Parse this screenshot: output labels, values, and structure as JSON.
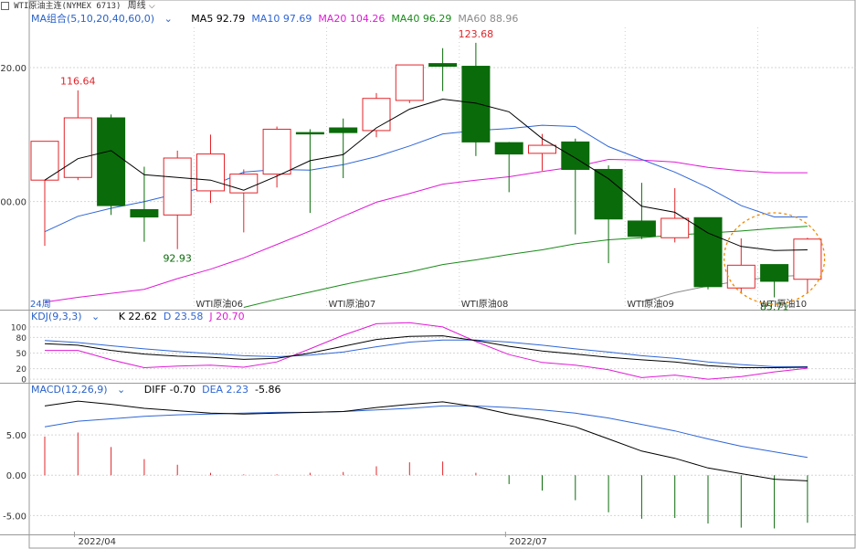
{
  "header": {
    "icon": "square-icon",
    "symbol": "WTI原油主连(NYMEX 6713)",
    "period": "周线",
    "dropdown_icon": "chevron-down-icon"
  },
  "colors": {
    "up": "#e2242a",
    "down": "#0a6b0a",
    "ma5": "#000000",
    "ma10": "#2f66d6",
    "ma20": "#e01ad6",
    "ma40": "#1a8a1a",
    "ma60": "#8a8a8a",
    "k": "#000000",
    "d": "#2f66d6",
    "j": "#e01ad6",
    "grid": "#d6d6d6",
    "axis_text": "#333333",
    "label_blue": "#2a62c9",
    "highlight_circle": "#f08a00"
  },
  "legends": {
    "ma": {
      "title": "MA组合(5,10,20,40,60,0)",
      "items": [
        {
          "text": "MA5 92.79",
          "color_key": "ma5"
        },
        {
          "text": "MA10 97.69",
          "color_key": "ma10"
        },
        {
          "text": "MA20 104.26",
          "color_key": "ma20"
        },
        {
          "text": "MA40 96.29",
          "color_key": "ma40"
        },
        {
          "text": "MA60 88.96",
          "color_key": "ma60"
        }
      ]
    },
    "kdj": {
      "title": "KDJ(9,3,3)",
      "items": [
        {
          "text": "K 22.62",
          "color_key": "k"
        },
        {
          "text": "D 23.58",
          "color_key": "d"
        },
        {
          "text": "J 20.70",
          "color_key": "j"
        }
      ]
    },
    "macd": {
      "title": "MACD(12,26,9)",
      "items": [
        {
          "text": "DIFF -0.70",
          "color_key": "k"
        },
        {
          "text": "DEA 2.23",
          "color_key": "d"
        },
        {
          "text": "-5.86",
          "color_key": "k"
        }
      ]
    }
  },
  "chart_data": {
    "type": "candlestick",
    "price_axis": {
      "ticks": [
        100,
        120
      ],
      "tick_labels": [
        "100.00",
        "120.00"
      ],
      "range": [
        84,
        126
      ]
    },
    "candles": [
      {
        "o": 103.2,
        "h": 108.5,
        "l": 93.4,
        "c": 109.0
      },
      {
        "o": 103.6,
        "h": 116.6,
        "l": 103.2,
        "c": 112.5
      },
      {
        "o": 112.5,
        "h": 113.0,
        "l": 98.0,
        "c": 99.4
      },
      {
        "o": 98.8,
        "h": 105.2,
        "l": 94.0,
        "c": 97.7
      },
      {
        "o": 98.0,
        "h": 107.6,
        "l": 92.9,
        "c": 106.5
      },
      {
        "o": 101.6,
        "h": 110.0,
        "l": 99.8,
        "c": 107.1
      },
      {
        "o": 101.3,
        "h": 104.8,
        "l": 95.4,
        "c": 104.1
      },
      {
        "o": 104.1,
        "h": 111.2,
        "l": 102.1,
        "c": 110.8
      },
      {
        "o": 110.3,
        "h": 110.8,
        "l": 98.3,
        "c": 110.2
      },
      {
        "o": 111.0,
        "h": 112.4,
        "l": 103.5,
        "c": 110.3
      },
      {
        "o": 110.6,
        "h": 116.2,
        "l": 109.6,
        "c": 115.4
      },
      {
        "o": 115.1,
        "h": 120.4,
        "l": 114.7,
        "c": 120.4
      },
      {
        "o": 120.6,
        "h": 122.9,
        "l": 116.5,
        "c": 120.2
      },
      {
        "o": 120.2,
        "h": 123.7,
        "l": 106.8,
        "c": 108.9
      },
      {
        "o": 108.8,
        "h": 108.9,
        "l": 101.4,
        "c": 107.1
      },
      {
        "o": 107.2,
        "h": 110.1,
        "l": 104.6,
        "c": 108.4
      },
      {
        "o": 108.9,
        "h": 109.4,
        "l": 95.1,
        "c": 104.8
      },
      {
        "o": 104.8,
        "h": 105.4,
        "l": 90.8,
        "c": 97.4
      },
      {
        "o": 97.1,
        "h": 102.8,
        "l": 94.4,
        "c": 94.8
      },
      {
        "o": 94.6,
        "h": 102.0,
        "l": 93.9,
        "c": 97.5
      },
      {
        "o": 97.6,
        "h": 97.6,
        "l": 86.9,
        "c": 87.3
      },
      {
        "o": 87.1,
        "h": 94.5,
        "l": 86.3,
        "c": 90.5
      },
      {
        "o": 90.6,
        "h": 90.6,
        "l": 85.7,
        "c": 88.1
      },
      {
        "o": 88.4,
        "h": 94.6,
        "l": 86.4,
        "c": 94.4
      }
    ],
    "ma": {
      "ma5": [
        103.2,
        106.4,
        107.6,
        104.0,
        103.6,
        103.2,
        101.7,
        103.8,
        106.1,
        107.0,
        111.0,
        113.8,
        115.3,
        114.7,
        113.4,
        109.4,
        106.5,
        103.4,
        99.3,
        98.4,
        95.3,
        93.3,
        92.7,
        92.8
      ],
      "ma10": [
        95.5,
        97.8,
        99.0,
        100.0,
        101.2,
        102.3,
        104.4,
        104.8,
        104.7,
        105.5,
        106.7,
        108.3,
        110.1,
        110.6,
        110.9,
        111.4,
        111.2,
        108.2,
        106.3,
        104.4,
        102.1,
        99.4,
        97.7,
        97.7
      ],
      "ma20": [
        85.0,
        85.7,
        86.3,
        86.9,
        88.5,
        89.9,
        91.6,
        93.6,
        95.6,
        97.8,
        99.9,
        101.2,
        102.6,
        103.2,
        103.7,
        104.5,
        105.2,
        106.3,
        106.2,
        105.9,
        105.1,
        104.6,
        104.3,
        104.3
      ],
      "ma40": [
        null,
        null,
        null,
        null,
        null,
        null,
        84.2,
        85.4,
        86.5,
        87.6,
        88.6,
        89.5,
        90.6,
        91.3,
        92.1,
        92.8,
        93.7,
        94.3,
        94.6,
        95.0,
        95.3,
        95.6,
        96.0,
        96.3
      ],
      "ma60": [
        null,
        null,
        null,
        null,
        null,
        null,
        null,
        null,
        null,
        null,
        null,
        null,
        null,
        null,
        null,
        null,
        null,
        null,
        85.0,
        86.4,
        87.4,
        88.2,
        88.8,
        89.0
      ]
    },
    "annotations": [
      {
        "index": 1,
        "value": 116.64,
        "text": "116.64",
        "position": "above",
        "color_key": "up"
      },
      {
        "index": 13,
        "value": 123.68,
        "text": "123.68",
        "position": "above",
        "color_key": "up"
      },
      {
        "index": 4,
        "value": 92.93,
        "text": "92.93",
        "position": "below",
        "color_key": "down"
      },
      {
        "index": 22,
        "value": 85.71,
        "text": "85.71",
        "position": "below",
        "color_key": "down"
      }
    ],
    "contract_marks": [
      {
        "index": 0,
        "text": "24周",
        "color_key": "label_blue"
      },
      {
        "index": 5,
        "text": "WTI原油06",
        "color_key": "axis_text"
      },
      {
        "index": 9,
        "text": "WTI原油07",
        "color_key": "axis_text"
      },
      {
        "index": 13,
        "text": "WTI原油08",
        "color_key": "axis_text"
      },
      {
        "index": 18,
        "text": "WTI原油09",
        "color_key": "axis_text"
      },
      {
        "index": 22,
        "text": "WTI原油10",
        "color_key": "axis_text"
      }
    ],
    "highlight_index": 22,
    "kdj": {
      "axis": {
        "ticks": [
          0,
          20,
          50,
          80,
          100
        ],
        "range": [
          -5,
          105
        ]
      },
      "k": [
        68,
        65,
        55,
        48,
        44,
        42,
        38,
        40,
        50,
        63,
        76,
        82,
        83,
        74,
        63,
        54,
        48,
        42,
        37,
        33,
        26,
        22,
        22,
        23
      ],
      "d": [
        74,
        70,
        64,
        58,
        53,
        49,
        45,
        43,
        46,
        52,
        62,
        71,
        75,
        75,
        71,
        65,
        58,
        52,
        45,
        40,
        33,
        28,
        24,
        24
      ],
      "j": [
        55,
        55,
        37,
        22,
        25,
        27,
        23,
        33,
        58,
        84,
        106,
        108,
        100,
        72,
        47,
        32,
        27,
        18,
        3,
        8,
        0,
        5,
        14,
        21
      ]
    },
    "macd": {
      "axis": {
        "ticks": [
          -5,
          0,
          5
        ],
        "tick_labels": [
          "-5.00",
          "0.00",
          "5.00"
        ],
        "range": [
          -7,
          10
        ]
      },
      "diff": [
        8.6,
        9.2,
        8.8,
        8.3,
        8.0,
        7.7,
        7.6,
        7.7,
        7.8,
        7.9,
        8.4,
        8.8,
        9.1,
        8.5,
        7.6,
        6.9,
        6.0,
        4.5,
        3.0,
        2.1,
        0.9,
        0.2,
        -0.5,
        -0.7
      ],
      "dea": [
        6.0,
        6.7,
        7.0,
        7.3,
        7.5,
        7.6,
        7.7,
        7.8,
        7.8,
        7.9,
        8.1,
        8.3,
        8.6,
        8.6,
        8.4,
        8.1,
        7.7,
        7.1,
        6.3,
        5.5,
        4.5,
        3.6,
        2.9,
        2.2
      ],
      "hist": [
        4.8,
        5.3,
        3.5,
        2.0,
        1.3,
        0.3,
        0.1,
        0.1,
        0.3,
        0.4,
        1.1,
        1.6,
        1.7,
        0.3,
        -1.1,
        -1.9,
        -3.1,
        -4.6,
        -5.4,
        -5.3,
        -6.0,
        -6.5,
        -6.6,
        -5.9
      ]
    },
    "date_labels": [
      {
        "index": 1.5,
        "text": "2022/04"
      },
      {
        "index": 14.5,
        "text": "2022/07"
      }
    ]
  }
}
